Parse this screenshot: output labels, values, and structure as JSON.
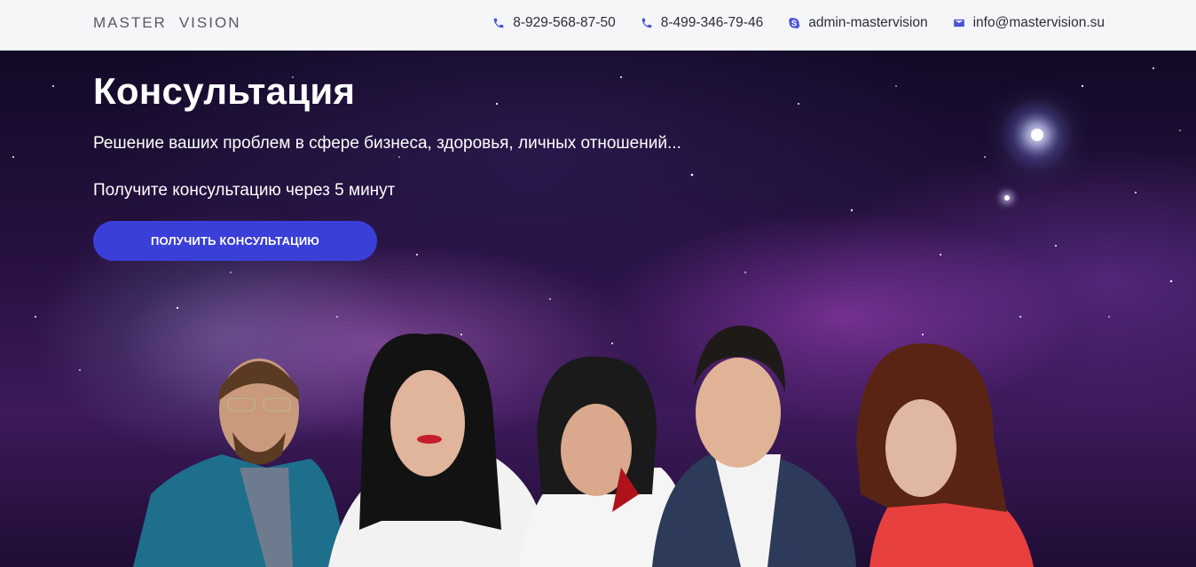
{
  "brand": {
    "logo_word1": "MASTER",
    "logo_word2": "VISION"
  },
  "header": {
    "contacts": [
      {
        "icon": "phone-icon",
        "text": "8-929-568-87-50"
      },
      {
        "icon": "phone-icon",
        "text": "8-499-346-79-46"
      },
      {
        "icon": "skype-icon",
        "text": "admin-mastervision"
      },
      {
        "icon": "mail-icon",
        "text": "info@mastervision.su"
      }
    ]
  },
  "hero": {
    "title": "Консультация",
    "subtitle": "Решение ваших проблем в сфере бизнеса, здоровья, личных отношений...",
    "subtitle2": "Получите консультацию через 5 минут",
    "cta_label": "ПОЛУЧИТЬ КОНСУЛЬТАЦИЮ"
  },
  "colors": {
    "accent": "#3a3fd8",
    "header_bg": "#f5f6f8",
    "icon": "#4a52d6"
  }
}
